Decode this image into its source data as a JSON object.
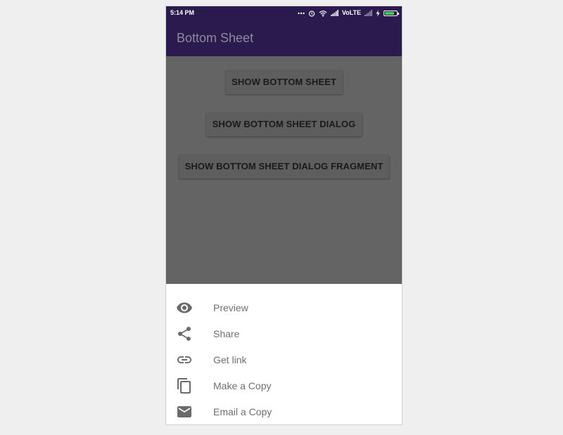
{
  "status_bar": {
    "time": "5:14 PM",
    "network": "VoLTE",
    "icons": [
      "more-dots-icon",
      "alarm-icon",
      "wifi-icon",
      "signal-icon",
      "signal-weak-icon",
      "charging-bolt-icon",
      "battery-icon"
    ],
    "battery_color": "#3bd14a",
    "battery_level": 0.85
  },
  "app_bar": {
    "title": "Bottom Sheet",
    "background": "#2a1a4e"
  },
  "buttons": {
    "show_bottom_sheet": "SHOW BOTTOM SHEET",
    "show_bottom_sheet_dialog": "SHOW BOTTOM SHEET DIALOG",
    "show_bottom_sheet_dialog_fragment": "SHOW BOTTOM SHEET DIALOG FRAGMENT"
  },
  "bottom_sheet": {
    "items": [
      {
        "label": "Preview",
        "icon": "eye-icon"
      },
      {
        "label": "Share",
        "icon": "share-icon"
      },
      {
        "label": "Get link",
        "icon": "link-icon"
      },
      {
        "label": "Make a Copy",
        "icon": "copy-icon"
      },
      {
        "label": "Email a Copy",
        "icon": "email-icon"
      }
    ]
  }
}
